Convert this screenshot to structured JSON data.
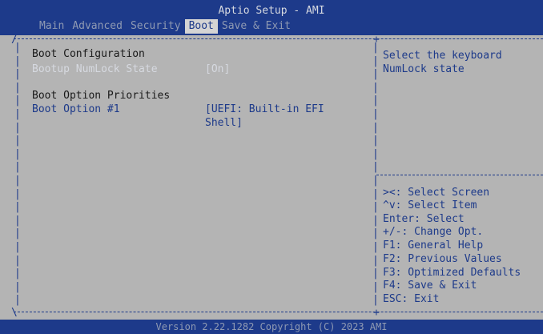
{
  "title": "Aptio Setup - AMI",
  "tabs": [
    "Main",
    "Advanced",
    "Security",
    "Boot",
    "Save & Exit"
  ],
  "active_tab": "Boot",
  "settings": {
    "boot_configuration_heading": "Boot Configuration",
    "numlock_label": "Bootup NumLock State",
    "numlock_value": "[On]",
    "boot_priorities_heading": "Boot Option Priorities",
    "boot_option1_label": "Boot Option #1",
    "boot_option1_value_line1": "[UEFI: Built-in EFI",
    "boot_option1_value_line2": "Shell]"
  },
  "help": {
    "description_line1": "Select the keyboard",
    "description_line2": "NumLock state",
    "keys": [
      "><: Select Screen",
      "^v: Select Item",
      "Enter: Select",
      "+/-: Change Opt.",
      "F1: General Help",
      "F2: Previous Values",
      "F3: Optimized Defaults",
      "F4: Save & Exit",
      "ESC: Exit"
    ]
  },
  "footer": "Version 2.22.1282 Copyright (C) 2023 AMI",
  "colors": {
    "bar": "#1d3a8a",
    "panel": "#b4b4b4",
    "highlight_text": "#d6d9e0"
  }
}
